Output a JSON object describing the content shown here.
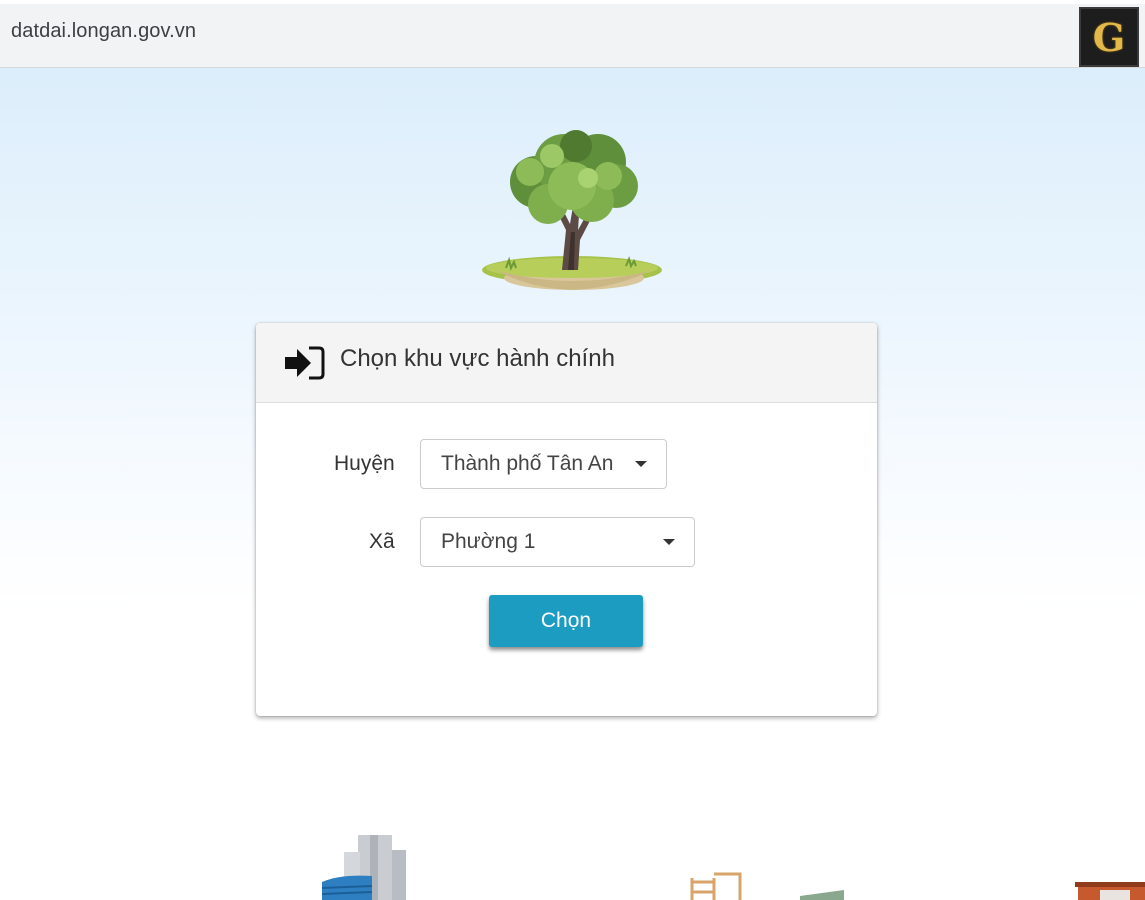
{
  "browser": {
    "url": "datdai.longan.gov.vn",
    "extension_letter": "G",
    "overflow_glyph": "⋮"
  },
  "card": {
    "title": "Chọn khu vực hành chính",
    "icon": "sign-in-icon",
    "district": {
      "label": "Huyện",
      "selected": "Thành phố Tân An"
    },
    "ward": {
      "label": "Xã",
      "selected": "Phường 1"
    },
    "submit_label": "Chọn"
  },
  "colors": {
    "button": "#1c9cc0",
    "page_top": "#dceefb",
    "header_bg": "#f4f4f4"
  }
}
